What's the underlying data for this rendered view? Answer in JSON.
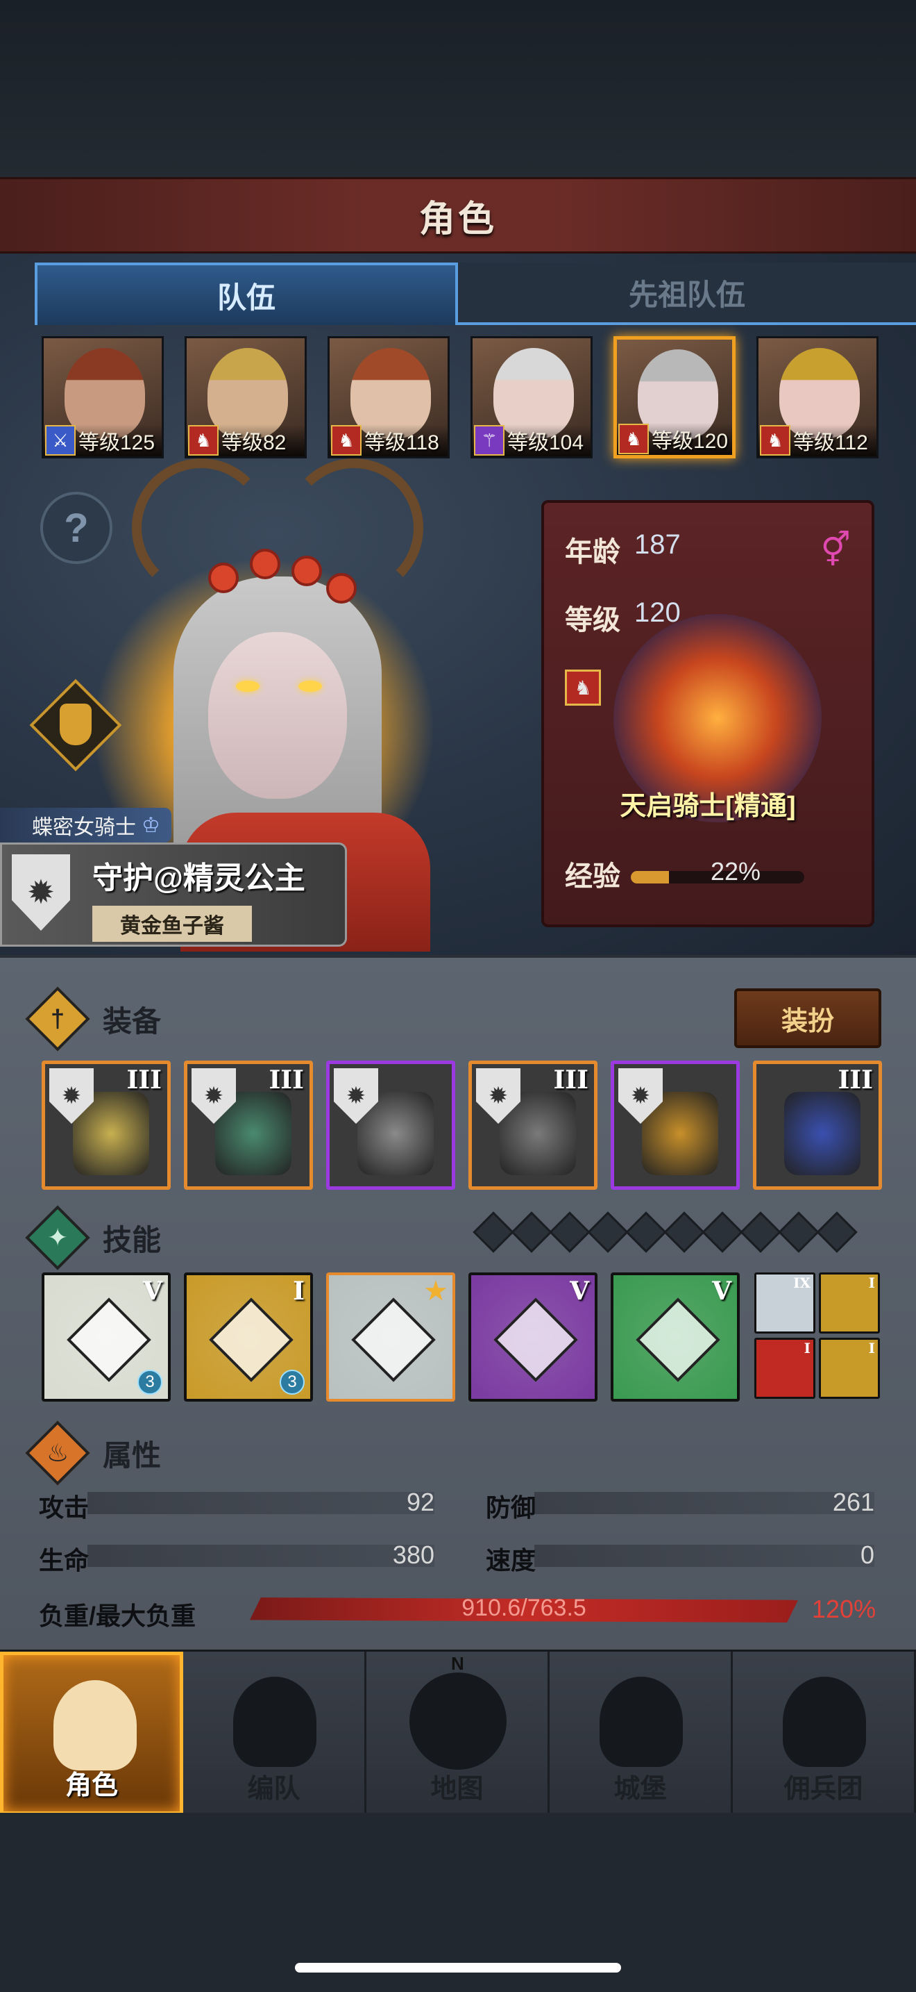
{
  "header": {
    "title": "角色"
  },
  "tabs": [
    {
      "label": "队伍",
      "active": true
    },
    {
      "label": "先祖队伍",
      "active": false
    }
  ],
  "party": [
    {
      "level_text": "等级125",
      "class_icon": "sword-icon",
      "badge_color": "blue",
      "hair": "#8a3a22",
      "skin": "#c89a80"
    },
    {
      "level_text": "等级82",
      "class_icon": "horse-icon",
      "badge_color": "red",
      "hair": "#c8a44a",
      "skin": "#d4b08e"
    },
    {
      "level_text": "等级118",
      "class_icon": "horse-icon",
      "badge_color": "red",
      "hair": "#a04a2a",
      "skin": "#e0c0a8"
    },
    {
      "level_text": "等级104",
      "class_icon": "staff-icon",
      "badge_color": "purple",
      "hair": "#d8d8d8",
      "skin": "#e8d0c8"
    },
    {
      "level_text": "等级120",
      "class_icon": "horse-icon",
      "badge_color": "red",
      "hair": "#b8b8b8",
      "skin": "#e2cfcf",
      "selected": true
    },
    {
      "level_text": "等级112",
      "class_icon": "horse-icon",
      "badge_color": "red",
      "hair": "#c8a030",
      "skin": "#e8c8c0"
    }
  ],
  "character": {
    "class_title": "蝶密女骑士",
    "name": "守护@精灵公主",
    "player": "黄金鱼子酱"
  },
  "info": {
    "age_label": "年龄",
    "age": "187",
    "level_label": "等级",
    "level": "120",
    "mount_name": "天启骑士[精通]",
    "exp_label": "经验",
    "exp_text": "22%",
    "exp_fraction": 0.22,
    "gender": "female"
  },
  "sections": {
    "equipment": "装备",
    "skills": "技能",
    "attributes": "属性"
  },
  "dress_button": "装扮",
  "equipment": [
    {
      "tier": "III",
      "rarity": "orange",
      "art": "#c8b050"
    },
    {
      "tier": "III",
      "rarity": "orange",
      "art": "#4a8a70"
    },
    {
      "tier": "",
      "rarity": "purple",
      "art": "#8a8a8a"
    },
    {
      "tier": "III",
      "rarity": "orange",
      "art": "#7a7a7a"
    },
    {
      "tier": "",
      "rarity": "purple",
      "art": "#c8902a"
    },
    {
      "tier": "III",
      "rarity": "orange",
      "art": "#3a50b0"
    }
  ],
  "skill_slots_total": 10,
  "skills": [
    {
      "tier": "V",
      "bg": "#d8dcd0",
      "count": "3"
    },
    {
      "tier": "I",
      "bg": "#c89a28",
      "count": "3"
    },
    {
      "tier": "",
      "bg": "#b8c0c0",
      "star": true
    },
    {
      "tier": "V",
      "bg": "#7a3aa0"
    },
    {
      "tier": "V",
      "bg": "#3a9a50"
    }
  ],
  "mini_skills": [
    {
      "tier": "IX",
      "bg": "#c8d0d8"
    },
    {
      "tier": "I",
      "bg": "#c89a28"
    },
    {
      "tier": "I",
      "bg": "#c02a22"
    },
    {
      "tier": "I",
      "bg": "#c89a28"
    }
  ],
  "stats": {
    "attack_label": "攻击",
    "attack": "92",
    "defense_label": "防御",
    "defense": "261",
    "hp_label": "生命",
    "hp": "380",
    "speed_label": "速度",
    "speed": "0",
    "weight_label": "负重/最大负重",
    "weight": "910.6/763.5",
    "weight_pct": "120%"
  },
  "nav": [
    {
      "label": "角色",
      "active": true
    },
    {
      "label": "编队",
      "active": false
    },
    {
      "label": "地图",
      "active": false
    },
    {
      "label": "城堡",
      "active": false
    },
    {
      "label": "佣兵团",
      "active": false
    }
  ],
  "compass_n": "N"
}
